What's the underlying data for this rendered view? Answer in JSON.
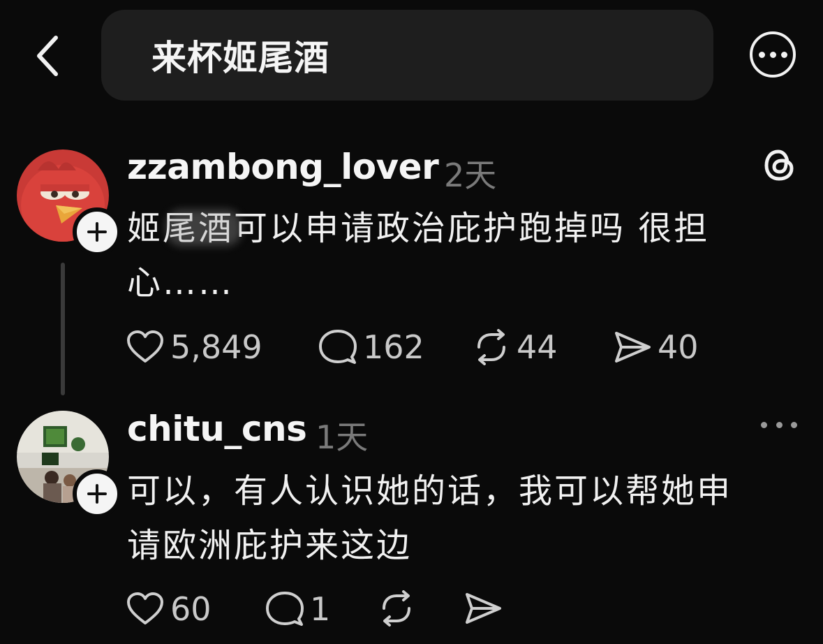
{
  "header": {
    "search_text": "来杯姬尾酒"
  },
  "posts": [
    {
      "username": "zzambong_lover",
      "time": "2天",
      "text": "姬尾酒可以申请政治庇护跑掉吗 很担\n心……",
      "likes": "5,849",
      "replies": "162",
      "reposts": "44",
      "shares": "40"
    },
    {
      "username": "chitu_cns",
      "time": "1天",
      "text": "可以，有人认识她的话，我可以帮她申\n请欧洲庇护来这边",
      "likes": "60",
      "replies": "1",
      "reposts": "",
      "shares": ""
    }
  ],
  "icons": {
    "back": "chevron-left-icon",
    "more": "more-horizontal-icon",
    "threads": "threads-logo-icon",
    "like": "heart-icon",
    "reply": "comment-icon",
    "repost": "repost-icon",
    "share": "send-icon"
  },
  "colors": {
    "background": "#0a0a0a",
    "search_bg": "#1e1e1e",
    "text": "#f3f3f3",
    "muted": "#7a7a7a"
  }
}
